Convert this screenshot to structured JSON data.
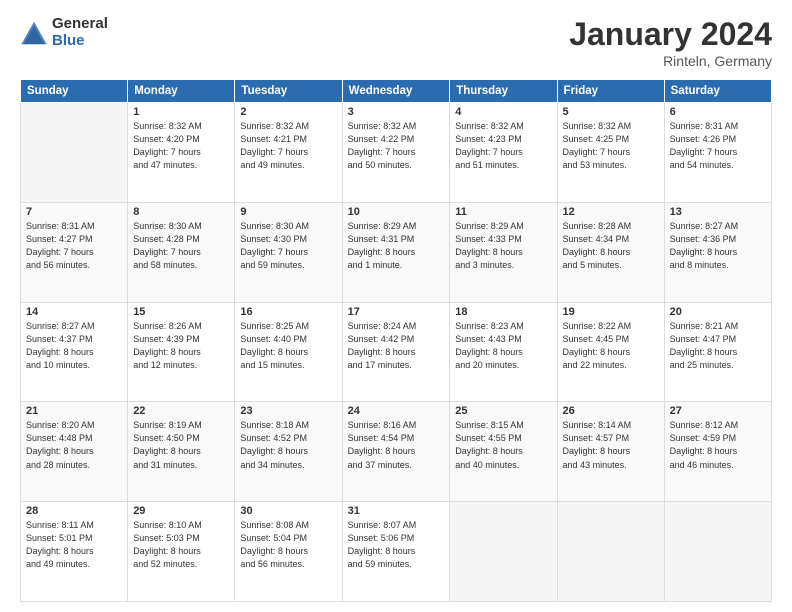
{
  "header": {
    "logo_general": "General",
    "logo_blue": "Blue",
    "month_title": "January 2024",
    "location": "Rinteln, Germany"
  },
  "days_of_week": [
    "Sunday",
    "Monday",
    "Tuesday",
    "Wednesday",
    "Thursday",
    "Friday",
    "Saturday"
  ],
  "weeks": [
    [
      {
        "num": "",
        "info": ""
      },
      {
        "num": "1",
        "info": "Sunrise: 8:32 AM\nSunset: 4:20 PM\nDaylight: 7 hours\nand 47 minutes."
      },
      {
        "num": "2",
        "info": "Sunrise: 8:32 AM\nSunset: 4:21 PM\nDaylight: 7 hours\nand 49 minutes."
      },
      {
        "num": "3",
        "info": "Sunrise: 8:32 AM\nSunset: 4:22 PM\nDaylight: 7 hours\nand 50 minutes."
      },
      {
        "num": "4",
        "info": "Sunrise: 8:32 AM\nSunset: 4:23 PM\nDaylight: 7 hours\nand 51 minutes."
      },
      {
        "num": "5",
        "info": "Sunrise: 8:32 AM\nSunset: 4:25 PM\nDaylight: 7 hours\nand 53 minutes."
      },
      {
        "num": "6",
        "info": "Sunrise: 8:31 AM\nSunset: 4:26 PM\nDaylight: 7 hours\nand 54 minutes."
      }
    ],
    [
      {
        "num": "7",
        "info": "Sunrise: 8:31 AM\nSunset: 4:27 PM\nDaylight: 7 hours\nand 56 minutes."
      },
      {
        "num": "8",
        "info": "Sunrise: 8:30 AM\nSunset: 4:28 PM\nDaylight: 7 hours\nand 58 minutes."
      },
      {
        "num": "9",
        "info": "Sunrise: 8:30 AM\nSunset: 4:30 PM\nDaylight: 7 hours\nand 59 minutes."
      },
      {
        "num": "10",
        "info": "Sunrise: 8:29 AM\nSunset: 4:31 PM\nDaylight: 8 hours\nand 1 minute."
      },
      {
        "num": "11",
        "info": "Sunrise: 8:29 AM\nSunset: 4:33 PM\nDaylight: 8 hours\nand 3 minutes."
      },
      {
        "num": "12",
        "info": "Sunrise: 8:28 AM\nSunset: 4:34 PM\nDaylight: 8 hours\nand 5 minutes."
      },
      {
        "num": "13",
        "info": "Sunrise: 8:27 AM\nSunset: 4:36 PM\nDaylight: 8 hours\nand 8 minutes."
      }
    ],
    [
      {
        "num": "14",
        "info": "Sunrise: 8:27 AM\nSunset: 4:37 PM\nDaylight: 8 hours\nand 10 minutes."
      },
      {
        "num": "15",
        "info": "Sunrise: 8:26 AM\nSunset: 4:39 PM\nDaylight: 8 hours\nand 12 minutes."
      },
      {
        "num": "16",
        "info": "Sunrise: 8:25 AM\nSunset: 4:40 PM\nDaylight: 8 hours\nand 15 minutes."
      },
      {
        "num": "17",
        "info": "Sunrise: 8:24 AM\nSunset: 4:42 PM\nDaylight: 8 hours\nand 17 minutes."
      },
      {
        "num": "18",
        "info": "Sunrise: 8:23 AM\nSunset: 4:43 PM\nDaylight: 8 hours\nand 20 minutes."
      },
      {
        "num": "19",
        "info": "Sunrise: 8:22 AM\nSunset: 4:45 PM\nDaylight: 8 hours\nand 22 minutes."
      },
      {
        "num": "20",
        "info": "Sunrise: 8:21 AM\nSunset: 4:47 PM\nDaylight: 8 hours\nand 25 minutes."
      }
    ],
    [
      {
        "num": "21",
        "info": "Sunrise: 8:20 AM\nSunset: 4:48 PM\nDaylight: 8 hours\nand 28 minutes."
      },
      {
        "num": "22",
        "info": "Sunrise: 8:19 AM\nSunset: 4:50 PM\nDaylight: 8 hours\nand 31 minutes."
      },
      {
        "num": "23",
        "info": "Sunrise: 8:18 AM\nSunset: 4:52 PM\nDaylight: 8 hours\nand 34 minutes."
      },
      {
        "num": "24",
        "info": "Sunrise: 8:16 AM\nSunset: 4:54 PM\nDaylight: 8 hours\nand 37 minutes."
      },
      {
        "num": "25",
        "info": "Sunrise: 8:15 AM\nSunset: 4:55 PM\nDaylight: 8 hours\nand 40 minutes."
      },
      {
        "num": "26",
        "info": "Sunrise: 8:14 AM\nSunset: 4:57 PM\nDaylight: 8 hours\nand 43 minutes."
      },
      {
        "num": "27",
        "info": "Sunrise: 8:12 AM\nSunset: 4:59 PM\nDaylight: 8 hours\nand 46 minutes."
      }
    ],
    [
      {
        "num": "28",
        "info": "Sunrise: 8:11 AM\nSunset: 5:01 PM\nDaylight: 8 hours\nand 49 minutes."
      },
      {
        "num": "29",
        "info": "Sunrise: 8:10 AM\nSunset: 5:03 PM\nDaylight: 8 hours\nand 52 minutes."
      },
      {
        "num": "30",
        "info": "Sunrise: 8:08 AM\nSunset: 5:04 PM\nDaylight: 8 hours\nand 56 minutes."
      },
      {
        "num": "31",
        "info": "Sunrise: 8:07 AM\nSunset: 5:06 PM\nDaylight: 8 hours\nand 59 minutes."
      },
      {
        "num": "",
        "info": ""
      },
      {
        "num": "",
        "info": ""
      },
      {
        "num": "",
        "info": ""
      }
    ]
  ]
}
